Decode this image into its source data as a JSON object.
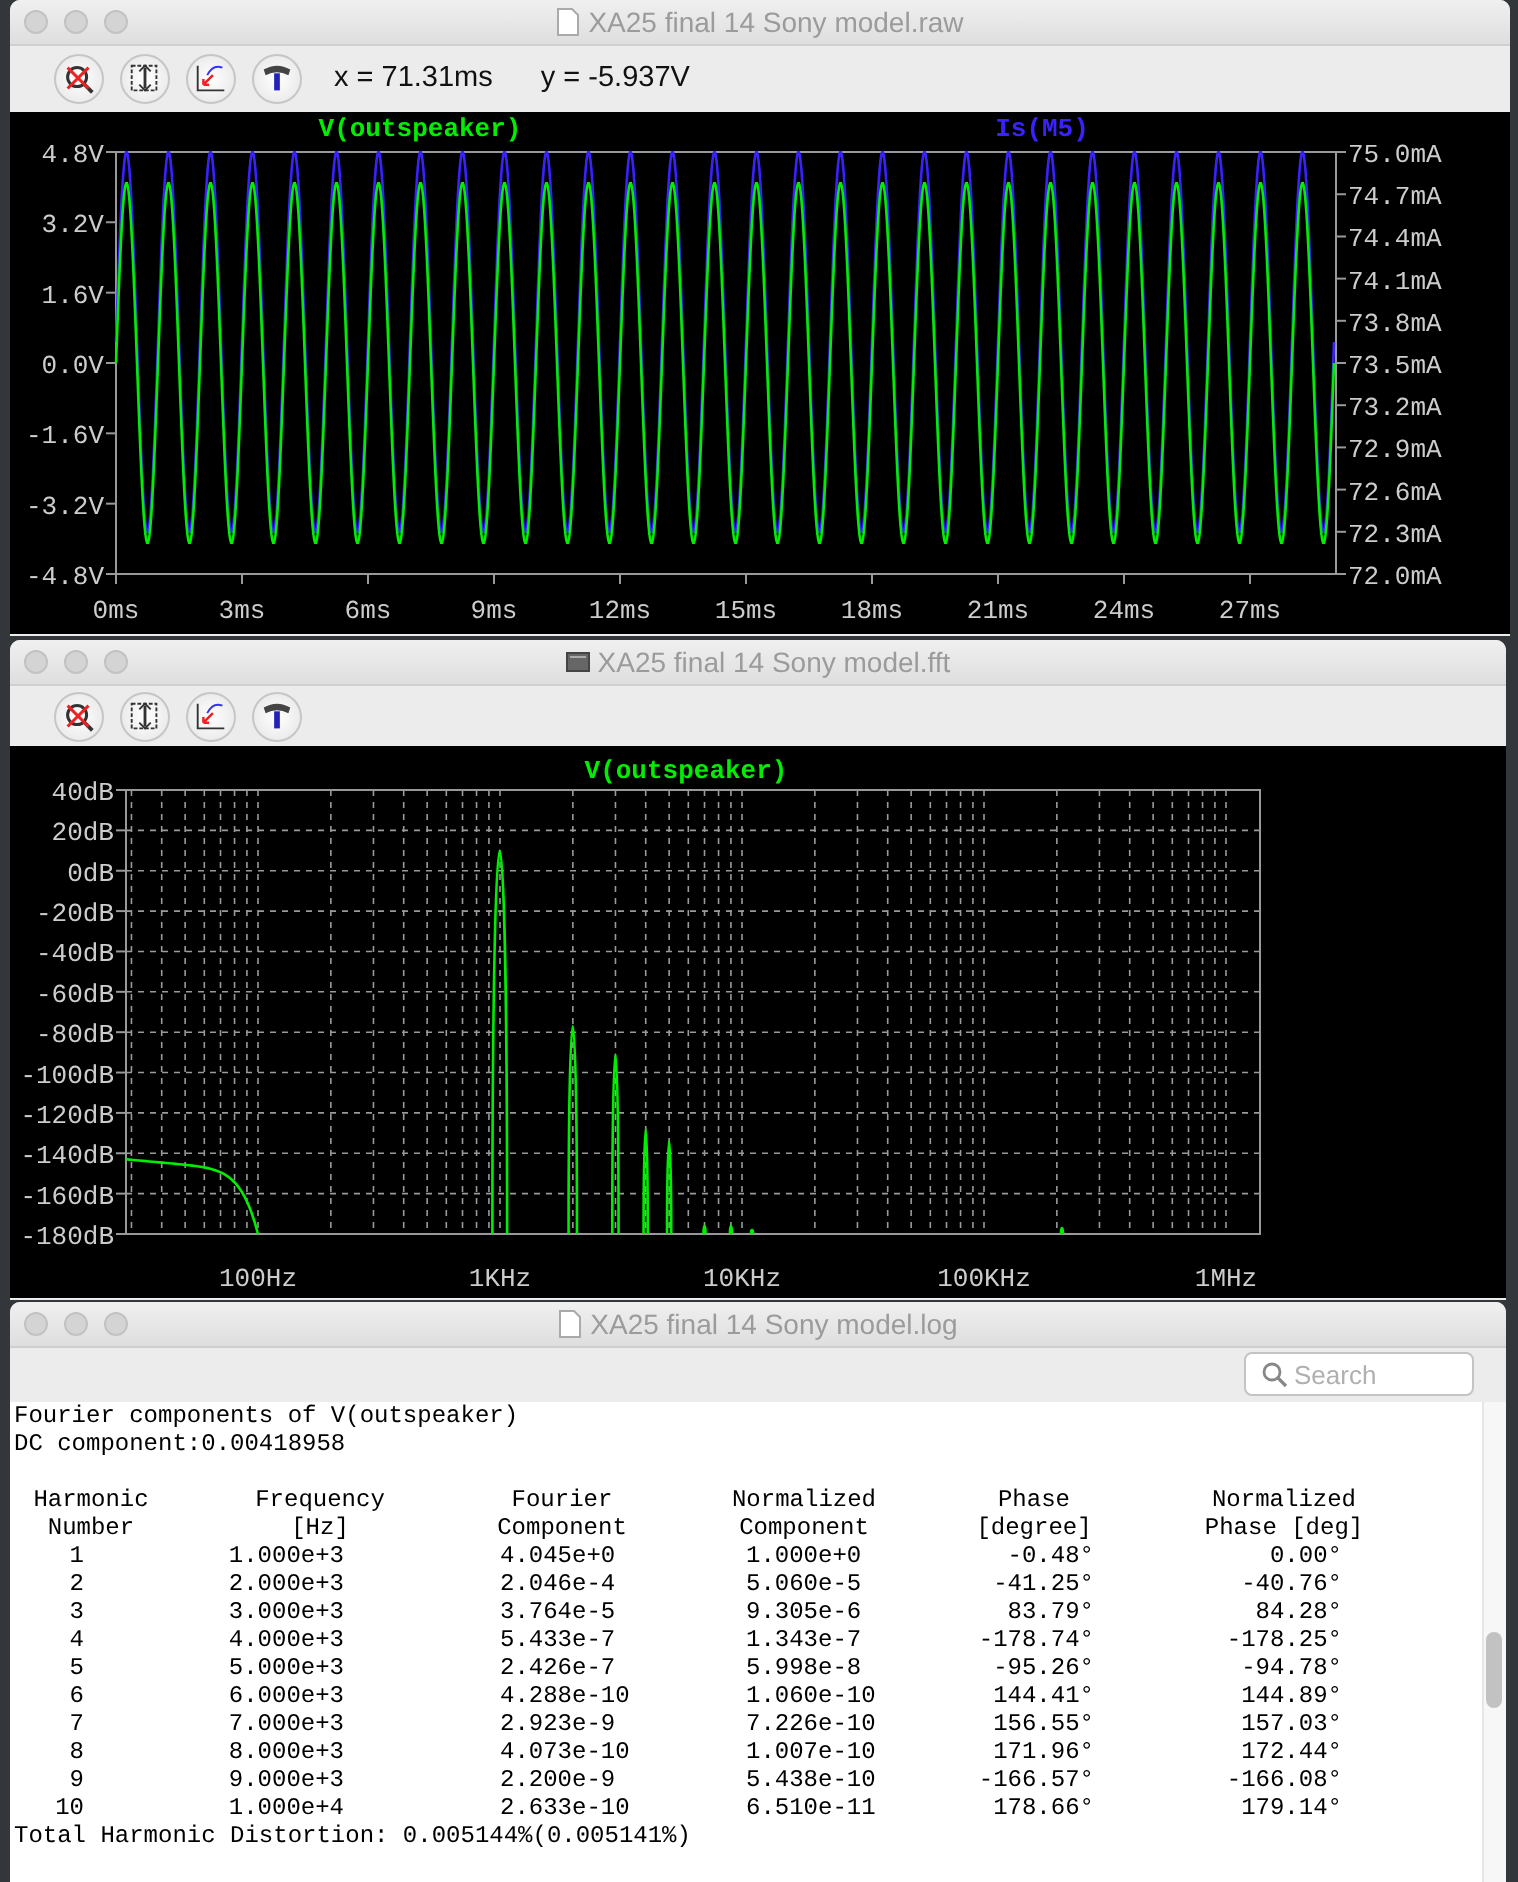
{
  "windows": [
    {
      "kind": "waveform",
      "title": "XA25 final 14 Sony model.raw",
      "readout": {
        "x": "x = 71.31ms",
        "y": "y = -5.937V"
      },
      "traces": [
        {
          "name": "V(outspeaker)",
          "color": "#00ee00"
        },
        {
          "name": "Is(M5)",
          "color": "#3a22ff"
        }
      ],
      "y_labels": [
        "4.8V",
        "3.2V",
        "1.6V",
        "0.0V",
        "-1.6V",
        "-3.2V",
        "-4.8V"
      ],
      "y2_labels": [
        "75.0mA",
        "74.7mA",
        "74.4mA",
        "74.1mA",
        "73.8mA",
        "73.5mA",
        "73.2mA",
        "72.9mA",
        "72.6mA",
        "72.3mA",
        "72.0mA"
      ],
      "x_labels": [
        "0ms",
        "3ms",
        "6ms",
        "9ms",
        "12ms",
        "15ms",
        "18ms",
        "21ms",
        "24ms",
        "27ms"
      ]
    },
    {
      "kind": "spectrum",
      "title": "XA25 final 14 Sony model.fft",
      "traces": [
        {
          "name": "V(outspeaker)",
          "color": "#00ee00"
        }
      ],
      "y_labels": [
        "40dB",
        "20dB",
        "0dB",
        "-20dB",
        "-40dB",
        "-60dB",
        "-80dB",
        "-100dB",
        "-120dB",
        "-140dB",
        "-160dB",
        "-180dB"
      ],
      "x_labels": [
        "100Hz",
        "1KHz",
        "10KHz",
        "100KHz",
        "1MHz"
      ]
    },
    {
      "kind": "log",
      "title": "XA25 final 14 Sony model.log",
      "search": {
        "placeholder": "Search"
      },
      "lines": [
        "Fourier components of V(outspeaker)",
        "DC component:0.00418958"
      ],
      "columns": [
        "Harmonic\nNumber",
        "Frequency\n[Hz]",
        "Fourier\nComponent",
        "Normalized\nComponent",
        "Phase\n[degree]",
        "Normalized\nPhase [deg]"
      ],
      "rows": [
        [
          "1",
          "1.000e+3",
          "4.045e+0",
          "1.000e+0",
          "-0.48°",
          "0.00°"
        ],
        [
          "2",
          "2.000e+3",
          "2.046e-4",
          "5.060e-5",
          "-41.25°",
          "-40.76°"
        ],
        [
          "3",
          "3.000e+3",
          "3.764e-5",
          "9.305e-6",
          "83.79°",
          "84.28°"
        ],
        [
          "4",
          "4.000e+3",
          "5.433e-7",
          "1.343e-7",
          "-178.74°",
          "-178.25°"
        ],
        [
          "5",
          "5.000e+3",
          "2.426e-7",
          "5.998e-8",
          "-95.26°",
          "-94.78°"
        ],
        [
          "6",
          "6.000e+3",
          "4.288e-10",
          "1.060e-10",
          "144.41°",
          "144.89°"
        ],
        [
          "7",
          "7.000e+3",
          "2.923e-9",
          "7.226e-10",
          "156.55°",
          "157.03°"
        ],
        [
          "8",
          "8.000e+3",
          "4.073e-10",
          "1.007e-10",
          "171.96°",
          "172.44°"
        ],
        [
          "9",
          "9.000e+3",
          "2.200e-9",
          "5.438e-10",
          "-166.57°",
          "-166.08°"
        ],
        [
          "10",
          "1.000e+4",
          "2.633e-10",
          "6.510e-11",
          "178.66°",
          "179.14°"
        ]
      ],
      "footer": "Total Harmonic Distortion: 0.005144%(0.005141%)"
    }
  ]
}
